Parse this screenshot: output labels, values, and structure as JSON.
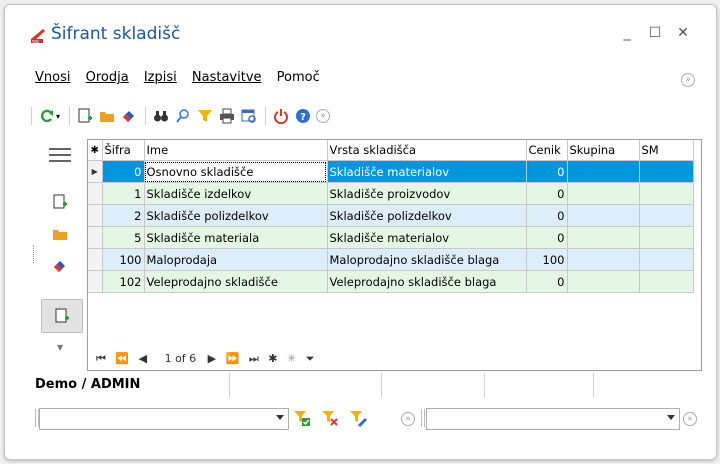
{
  "window": {
    "title": "Šifrant skladišč"
  },
  "menu": {
    "items": [
      "Vnosi",
      "Orodja",
      "Izpisi",
      "Nastavitve",
      "Pomoč"
    ]
  },
  "toolbar": {
    "icons": [
      "refresh-icon",
      "new-icon",
      "open-folder-icon",
      "eraser-icon",
      "binoculars-icon",
      "search-icon",
      "filter-icon",
      "print-icon",
      "report-icon",
      "power-icon",
      "help-icon",
      "more-icon"
    ]
  },
  "grid": {
    "columns": [
      "Šifra",
      "Ime",
      "Vrsta skladišča",
      "Cenik",
      "Skupina",
      "SM"
    ],
    "rows": [
      {
        "sifra": "0",
        "ime": "Osnovno skladišče",
        "vrsta": "Skladišče materialov",
        "cenik": "0",
        "skupina": "",
        "sm": ""
      },
      {
        "sifra": "1",
        "ime": "Skladišče izdelkov",
        "vrsta": "Skladišče proizvodov",
        "cenik": "0",
        "skupina": "",
        "sm": ""
      },
      {
        "sifra": "2",
        "ime": "Skladišče polizdelkov",
        "vrsta": "Skladišče polizdelkov",
        "cenik": "0",
        "skupina": "",
        "sm": ""
      },
      {
        "sifra": "5",
        "ime": "Skladišče materiala",
        "vrsta": "Skladišče materialov",
        "cenik": "0",
        "skupina": "",
        "sm": ""
      },
      {
        "sifra": "100",
        "ime": "Maloprodaja",
        "vrsta": "Maloprodajno skladišče blaga",
        "cenik": "100",
        "skupina": "",
        "sm": ""
      },
      {
        "sifra": "102",
        "ime": "Veleprodajno skladišče",
        "vrsta": "Veleprodajno skladišče blaga",
        "cenik": "0",
        "skupina": "",
        "sm": ""
      }
    ],
    "navigator": {
      "page_text": "1 of 6"
    }
  },
  "status": {
    "user": "Demo / ADMIN"
  },
  "bottom": {
    "combo_left": "",
    "combo_right": ""
  },
  "colors": {
    "selected": "#0096db",
    "row_blue": "#dceefa",
    "row_green": "#e4f7e4",
    "title": "#1a56a8"
  }
}
